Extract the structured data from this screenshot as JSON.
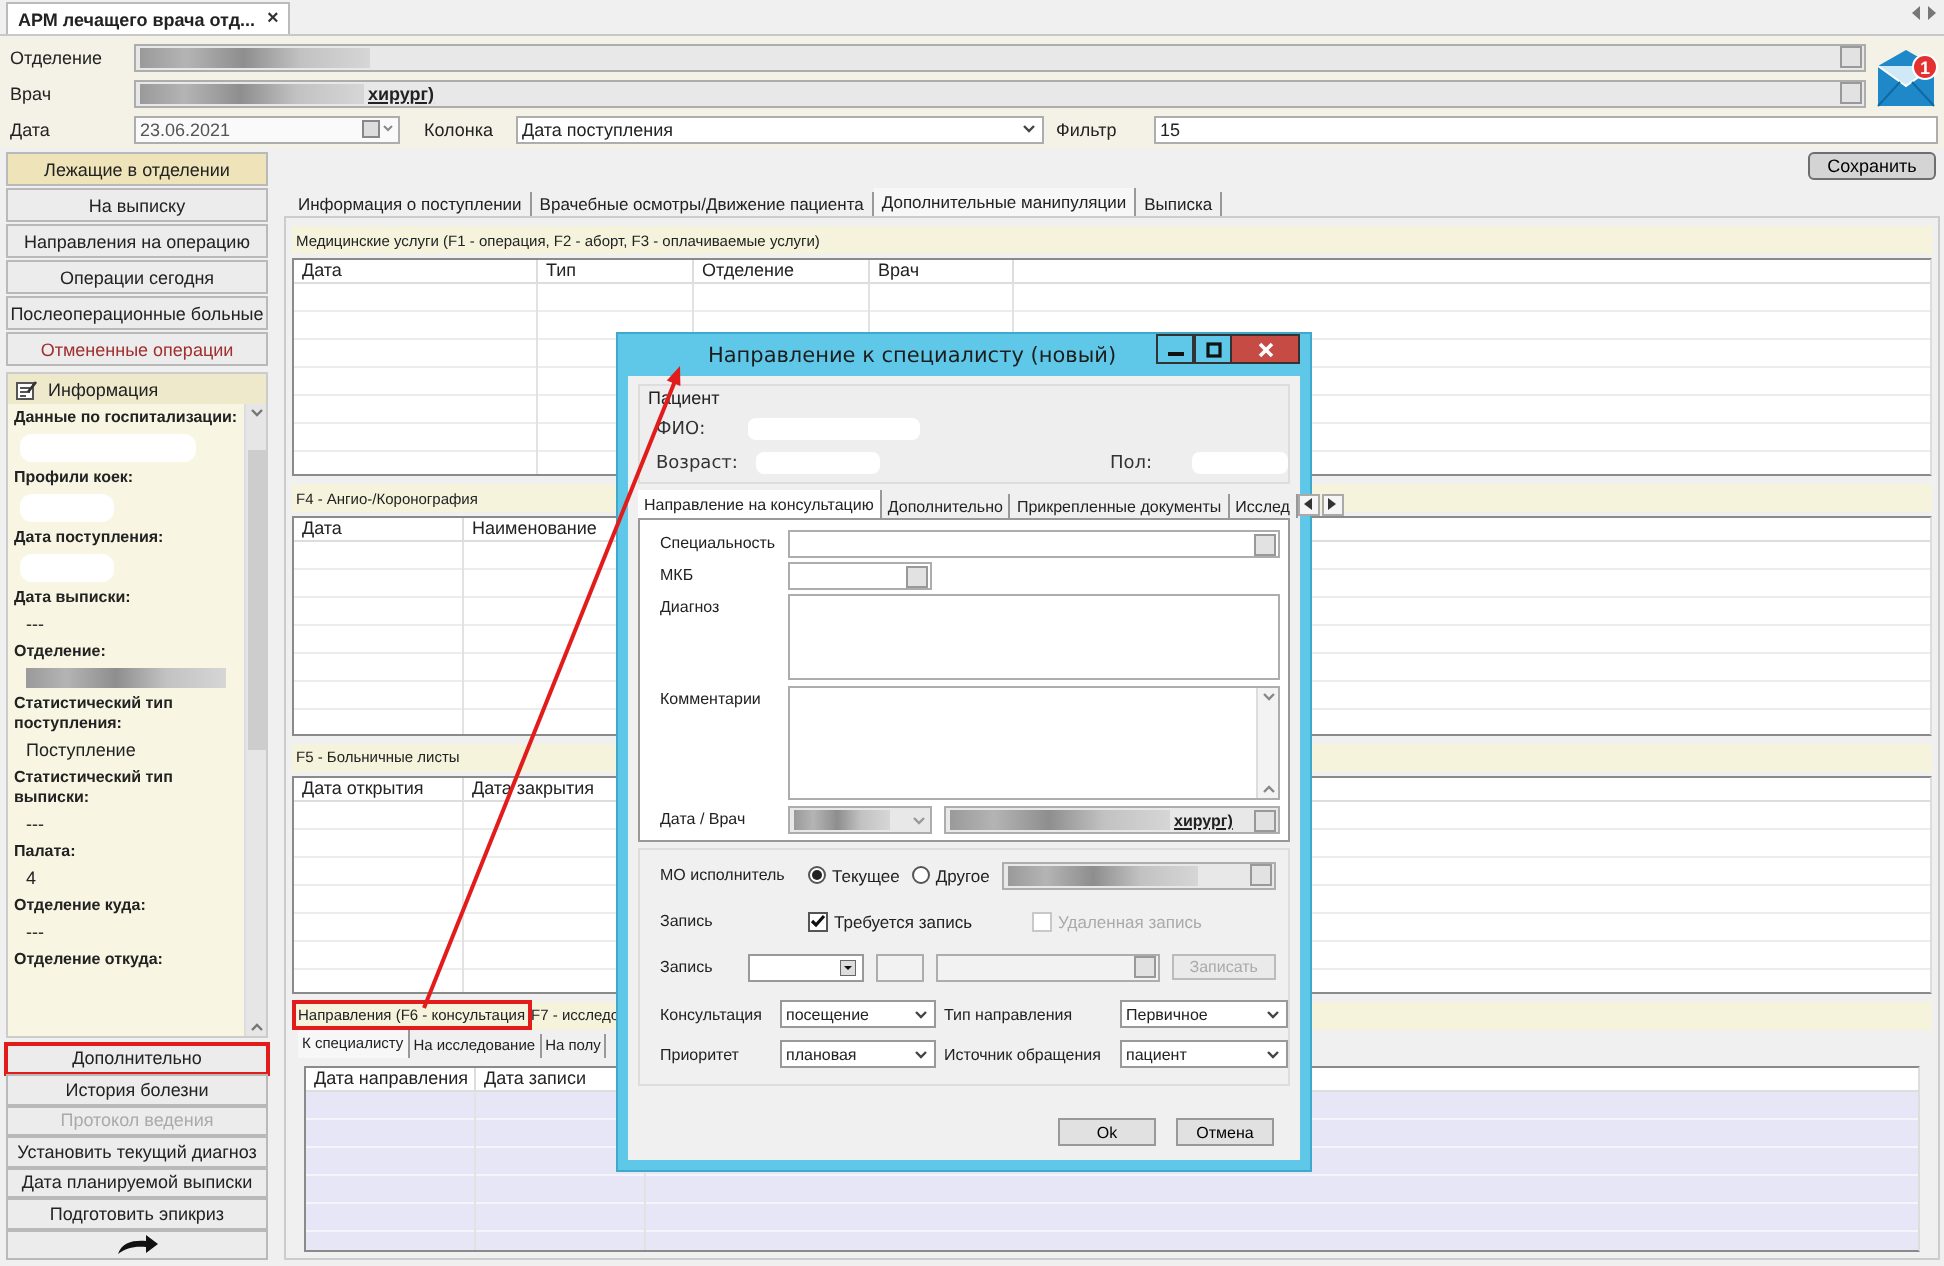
{
  "app_tab": {
    "title": "АРМ лечащего врача отд...",
    "close": "×"
  },
  "header": {
    "department": {
      "label": "Отделение"
    },
    "doctor": {
      "label": "Врач",
      "value_visible": "хирург)"
    },
    "date": {
      "label": "Дата",
      "value": "23.06.2021"
    },
    "column": {
      "label": "Колонка",
      "value": "Дата поступления"
    },
    "filter": {
      "label": "Фильтр",
      "value": "15"
    }
  },
  "notifications": {
    "badge": "1"
  },
  "sidebar": {
    "nav": [
      {
        "label": "Лежащие в отделении",
        "selected": true,
        "kind": "normal"
      },
      {
        "label": "На выписку",
        "selected": false,
        "kind": "normal"
      },
      {
        "label": "Направления на операцию",
        "selected": false,
        "kind": "normal"
      },
      {
        "label": "Операции сегодня",
        "selected": false,
        "kind": "normal"
      },
      {
        "label": "Послеоперационные больные",
        "selected": false,
        "kind": "normal"
      },
      {
        "label": "Отмененные операции",
        "selected": false,
        "kind": "warning"
      }
    ],
    "info": {
      "title": "Информация",
      "fields": [
        {
          "label": "Данные по госпитализации:",
          "kind": "blank"
        },
        {
          "label": "Профили коек:",
          "kind": "blank"
        },
        {
          "label": "Дата поступления:",
          "kind": "blank"
        },
        {
          "label": "Дата выписки:",
          "kind": "text",
          "value": "---"
        },
        {
          "label": "Отделение:",
          "kind": "redacted"
        },
        {
          "label": "Статистический тип поступления:",
          "kind": "text",
          "value": "Поступление"
        },
        {
          "label": "Статистический тип выписки:",
          "kind": "text",
          "value": "---"
        },
        {
          "label": "Палата:",
          "kind": "text",
          "value": "4"
        },
        {
          "label": "Отделение куда:",
          "kind": "text",
          "value": "---"
        },
        {
          "label": "Отделение откуда:",
          "kind": "none"
        }
      ]
    },
    "actions": [
      {
        "kind": "text",
        "label": "Дополнительно",
        "disabled": false,
        "highlighted": true
      },
      {
        "kind": "text",
        "label": "История болезни",
        "disabled": false,
        "highlighted": false
      },
      {
        "kind": "text",
        "label": "Протокол ведения",
        "disabled": true,
        "highlighted": false
      },
      {
        "kind": "text",
        "label": "Установить текущий диагноз",
        "disabled": false,
        "highlighted": false
      },
      {
        "kind": "text",
        "label": "Дата планируемой выписки",
        "disabled": false,
        "highlighted": false
      },
      {
        "kind": "text",
        "label": "Подготовить эпикриз",
        "disabled": false,
        "highlighted": false
      },
      {
        "kind": "icon",
        "disabled": false,
        "highlighted": false
      }
    ]
  },
  "save_button": "Сохранить",
  "tabs": [
    {
      "label": "Информация о поступлении",
      "selected": false
    },
    {
      "label": "Врачебные осмотры/Движение пациента",
      "selected": false
    },
    {
      "label": "Дополнительные манипуляции",
      "selected": true
    },
    {
      "label": "Выписка",
      "selected": false
    }
  ],
  "sections": [
    {
      "title": "Медицинские услуги (F1 - операция, F2 - аборт, F3 - оплачиваемые услуги)",
      "highlighted": false,
      "focused": false,
      "columns": [
        "Дата",
        "Тип",
        "Отделение",
        "Врач"
      ]
    },
    {
      "title": "F4 - Ангио-/Коронография",
      "highlighted": false,
      "focused": false,
      "columns": [
        "Дата",
        "Наименование"
      ]
    },
    {
      "title": "F5 - Больничные листы",
      "highlighted": false,
      "focused": false,
      "columns": [
        "Дата открытия",
        "Дата закрытия"
      ]
    },
    {
      "title": "Направления (F6 - консультация",
      "title_2": "F7 - исследо",
      "highlighted": true,
      "focused": true,
      "subtabs": [
        {
          "label": "К специалисту",
          "selected": true
        },
        {
          "label": "На исследование",
          "selected": false
        },
        {
          "label": "На полу",
          "selected": false
        }
      ],
      "columns": [
        "Дата направления",
        "Дата записи"
      ]
    }
  ],
  "dialog": {
    "title": "Направление к специалисту (новый)",
    "patient": {
      "legend": "Пациент",
      "fio_label": "ФИО:",
      "age_label": "Возраст:",
      "sex_label": "Пол:"
    },
    "tabs": [
      {
        "label": "Направление на консультацию",
        "selected": true
      },
      {
        "label": "Дополнительно",
        "selected": false
      },
      {
        "label": "Прикрепленные документы",
        "selected": false
      },
      {
        "label": "Исслед",
        "selected": false
      }
    ],
    "fields": {
      "specialty": "Специальность",
      "mkb": "МКБ",
      "diagnosis": "Диагноз",
      "comments": "Комментарии",
      "date_doctor": "Дата / Врач",
      "doctor_visible": "хирург)"
    },
    "executor": {
      "label": "МО исполнитель",
      "options": [
        {
          "label": "Текущее",
          "selected": true
        },
        {
          "label": "Другое",
          "selected": false
        }
      ]
    },
    "booking": {
      "label": "Запись",
      "checks": [
        {
          "label": "Требуется запись",
          "checked": true,
          "disabled": false
        },
        {
          "label": "Удаленная запись",
          "checked": false,
          "disabled": true
        }
      ]
    },
    "booking2": {
      "label": "Запись",
      "button": "Записать",
      "button_disabled": true
    },
    "selects": [
      {
        "label": "Консультация",
        "value": "посещение"
      },
      {
        "label": "Тип направления",
        "value": "Первичное"
      },
      {
        "label": "Приоритет",
        "value": "плановая"
      },
      {
        "label": "Источник обращения",
        "value": "пациент"
      }
    ],
    "buttons": [
      "Ok",
      "Отмена"
    ]
  }
}
